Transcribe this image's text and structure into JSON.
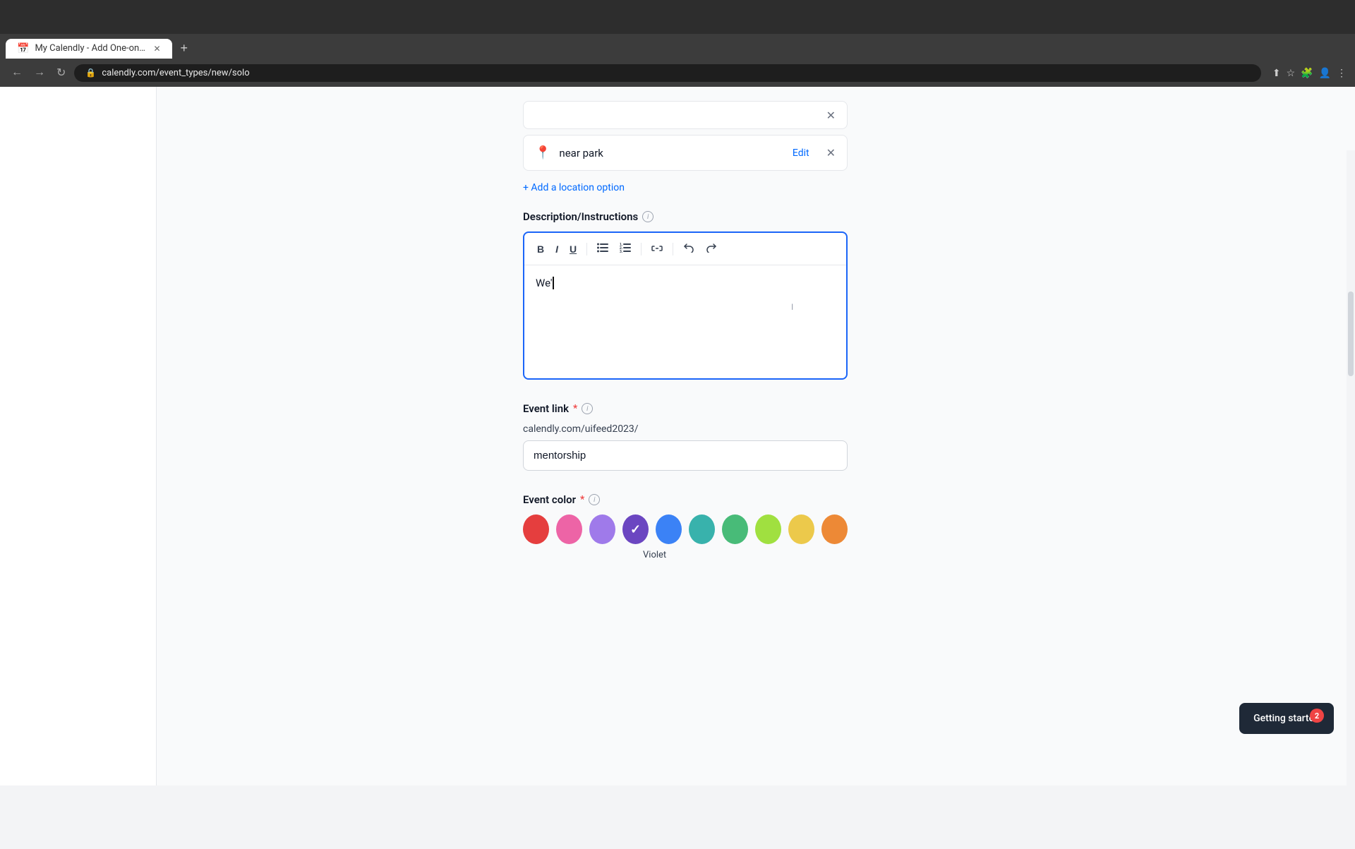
{
  "browser": {
    "tab_title": "My Calendly - Add One-on-One",
    "tab_favicon": "📅",
    "url": "calendly.com/event_types/new/solo",
    "new_tab_label": "+"
  },
  "location_card": {
    "location_text": "near park",
    "edit_label": "Edit",
    "icon": "📍"
  },
  "add_location": {
    "label": "+ Add a location option"
  },
  "description": {
    "label": "Description/Instructions",
    "content": "We'",
    "toolbar": {
      "bold": "B",
      "italic": "I",
      "underline": "U",
      "bullet_list": "☰",
      "numbered_list": "☰",
      "link": "🔗",
      "undo": "↩",
      "redo": "↪"
    }
  },
  "event_link": {
    "label": "Event link",
    "required": true,
    "prefix": "calendly.com/uifeed2023/",
    "value": "mentorship"
  },
  "event_color": {
    "label": "Event color",
    "required": true,
    "selected_color_label": "Violet",
    "colors": [
      {
        "name": "red",
        "hex": "#e53e3e",
        "selected": false
      },
      {
        "name": "pink",
        "hex": "#ed64a6",
        "selected": false
      },
      {
        "name": "purple",
        "hex": "#9f7aea",
        "selected": false
      },
      {
        "name": "violet",
        "hex": "#6b46c1",
        "selected": true
      },
      {
        "name": "blue",
        "hex": "#3b82f6",
        "selected": false
      },
      {
        "name": "teal",
        "hex": "#38b2ac",
        "selected": false
      },
      {
        "name": "green",
        "hex": "#48bb78",
        "selected": false
      },
      {
        "name": "lime",
        "hex": "#a0e040",
        "selected": false
      },
      {
        "name": "yellow",
        "hex": "#ecc94b",
        "selected": false
      },
      {
        "name": "orange",
        "hex": "#ed8936",
        "selected": false
      }
    ]
  },
  "toast": {
    "label": "Getting started",
    "badge_count": "2"
  }
}
